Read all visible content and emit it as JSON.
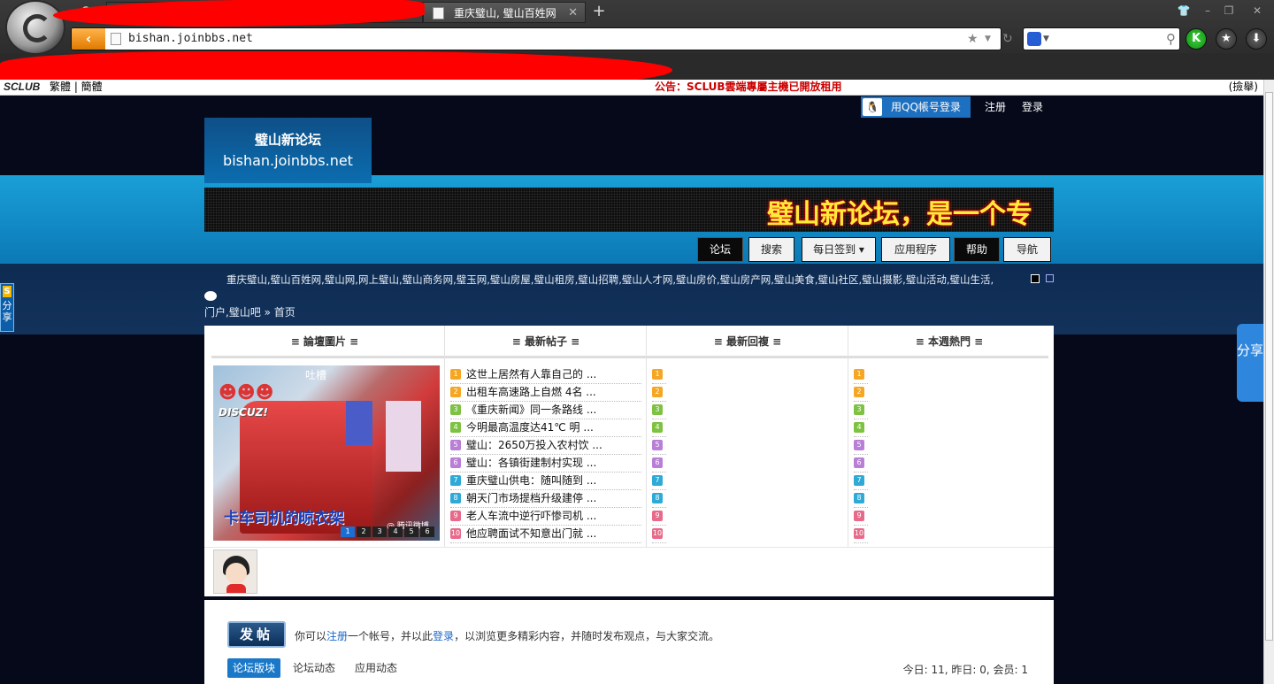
{
  "browser": {
    "active_tab_title": "重庆璧山, 璧山百姓网",
    "url": "bishan.joinbbs.net"
  },
  "sclub_bar": {
    "logo": "SCLUB",
    "links": "繁體 | 簡體",
    "announcement": "公告：SCLUB雲端專屬主機已開放租用",
    "right": "(撿舉)"
  },
  "header": {
    "qq_login": "用QQ帳号登录",
    "register": "注册",
    "login": "登录",
    "site_title": "璧山新论坛",
    "site_domain": "bishan.joinbbs.net",
    "banner_text": "璧山新论坛，是一个专"
  },
  "nav": {
    "items": [
      {
        "label": "论坛",
        "dark": true
      },
      {
        "label": "搜索",
        "dark": false
      },
      {
        "label": "每日签到 ▾",
        "dark": false
      },
      {
        "label": "应用程序",
        "dark": false
      },
      {
        "label": "帮助",
        "dark": true
      },
      {
        "label": "导航",
        "dark": false
      }
    ]
  },
  "keywords": "重庆璧山,璧山百姓网,璧山网,网上璧山,璧山商务网,璧玉网,璧山房屋,璧山租房,璧山招聘,璧山人才网,璧山房价,璧山房产网,璧山美食,璧山社区,璧山摄影,璧山活动,璧山生活,",
  "breadcrumb": "门户,璧山吧 » 首页",
  "share": {
    "left": "分享",
    "right": "分享"
  },
  "portal": {
    "columns": [
      "≡ 論壇圖片 ≡",
      "≡ 最新帖子 ≡",
      "≡ 最新回複 ≡",
      "≡ 本週熱門 ≡"
    ],
    "slideshow": {
      "tag": "吐槽",
      "brand": "DISCUZ!",
      "caption": "卡车司机的晾衣架",
      "watermark": "@ 腾讯微博",
      "pages": [
        "1",
        "2",
        "3",
        "4",
        "5",
        "6"
      ]
    },
    "latest_threads": [
      "这世上居然有人靠自己的 ...",
      "出租车高速路上自燃 4名 ...",
      "《重庆新闻》同一条路线 ...",
      "今明最高温度达41℃ 明 ...",
      "璧山：2650万投入农村饮 ...",
      "璧山：各镇街建制村实现 ...",
      "重庆璧山供电：随叫随到 ...",
      "朝天门市场提档升级建停 ...",
      "老人车流中逆行吓惨司机 ...",
      "他应聘面试不知意出门就 ..."
    ],
    "rank_numbers": [
      "1",
      "2",
      "3",
      "4",
      "5",
      "6",
      "7",
      "8",
      "9",
      "10"
    ],
    "rank_colors": [
      "#f5a623",
      "#f5a623",
      "#7dc242",
      "#7dc242",
      "#b97fd6",
      "#b97fd6",
      "#2fa9d6",
      "#2fa9d6",
      "#e86a8a",
      "#e86a8a"
    ]
  },
  "post_panel": {
    "post_button": "发帖",
    "msg_prefix": "你可以",
    "msg_register": "注册",
    "msg_middle": "一个帐号，并以此",
    "msg_login": "登录",
    "msg_suffix": "，以浏览更多精彩内容，并随时发布观点，与大家交流。",
    "tabs": [
      "论坛版块",
      "论坛动态",
      "应用动态"
    ],
    "stats": "今日: 11, 昨日: 0, 会员: 1"
  }
}
